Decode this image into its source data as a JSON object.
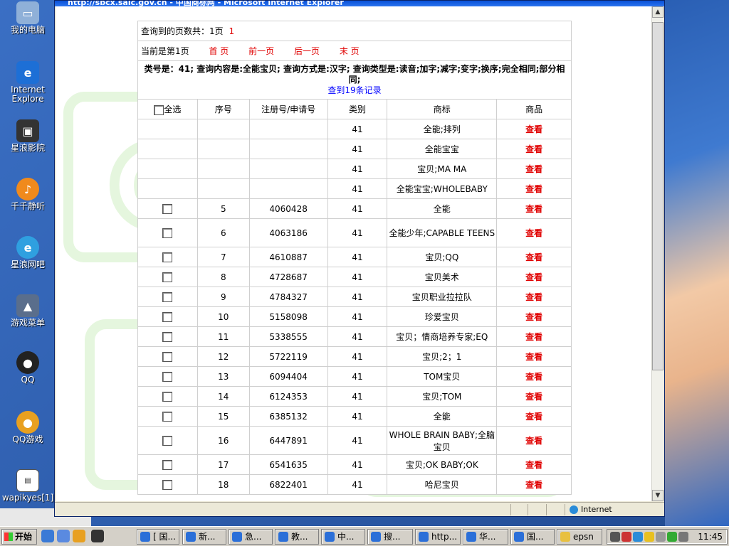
{
  "window": {
    "title": "http://sbcx.saic.gov.cn - 中国商标网 - Microsoft Internet Explorer",
    "status_zone": "Internet"
  },
  "desktop": {
    "icons": [
      "我的电脑",
      "Internet Explore",
      "星浪影院",
      "千千静听",
      "星浪网吧",
      "游戏菜单",
      "QQ",
      "QQ游戏",
      "wapikyes[1]"
    ]
  },
  "results": {
    "pages_label": "查询到的页数共：1页",
    "pages_link": "1",
    "current_label": "当前是第1页",
    "nav": [
      "首 页",
      "前一页",
      "后一页",
      "末 页"
    ],
    "info_line": "类号是：41; 查询内容是:全能宝贝; 查询方式是:汉字; 查询类型是:读音;加字;减字;变字;换序;完全相同;部分相同;",
    "found": "查到19条记录",
    "headers": {
      "select_all": "全选",
      "seq": "序号",
      "regno": "注册号/申请号",
      "class": "类别",
      "mark": "商标",
      "goods": "商品"
    },
    "view_label": "查看",
    "rows": [
      {
        "seq": "",
        "regno": "",
        "class": "41",
        "mark": "全能;排列",
        "hidden": true
      },
      {
        "seq": "",
        "regno": "",
        "class": "41",
        "mark": "全能宝宝",
        "hidden": true
      },
      {
        "seq": "",
        "regno": "",
        "class": "41",
        "mark": "宝贝;MA MA",
        "hidden": true
      },
      {
        "seq": "",
        "regno": "",
        "class": "41",
        "mark": "全能宝宝;WHOLEBABY",
        "hidden": true
      },
      {
        "seq": "5",
        "regno": "4060428",
        "class": "41",
        "mark": "全能"
      },
      {
        "seq": "6",
        "regno": "4063186",
        "class": "41",
        "mark": "全能少年;CAPABLE TEENS",
        "tall": true
      },
      {
        "seq": "7",
        "regno": "4610887",
        "class": "41",
        "mark": "宝贝;QQ"
      },
      {
        "seq": "8",
        "regno": "4728687",
        "class": "41",
        "mark": "宝贝美术"
      },
      {
        "seq": "9",
        "regno": "4784327",
        "class": "41",
        "mark": "宝贝职业拉拉队"
      },
      {
        "seq": "10",
        "regno": "5158098",
        "class": "41",
        "mark": "珍爱宝贝"
      },
      {
        "seq": "11",
        "regno": "5338555",
        "class": "41",
        "mark": "宝贝；情商培养专家;EQ"
      },
      {
        "seq": "12",
        "regno": "5722119",
        "class": "41",
        "mark": "宝贝;2；1"
      },
      {
        "seq": "13",
        "regno": "6094404",
        "class": "41",
        "mark": "TOM宝贝"
      },
      {
        "seq": "14",
        "regno": "6124353",
        "class": "41",
        "mark": "宝贝;TOM"
      },
      {
        "seq": "15",
        "regno": "6385132",
        "class": "41",
        "mark": "全能"
      },
      {
        "seq": "16",
        "regno": "6447891",
        "class": "41",
        "mark": "WHOLE BRAIN BABY;全脑宝贝",
        "tall": true
      },
      {
        "seq": "17",
        "regno": "6541635",
        "class": "41",
        "mark": "宝贝;OK BABY;OK"
      },
      {
        "seq": "18",
        "regno": "6822401",
        "class": "41",
        "mark": "哈尼宝贝"
      }
    ]
  },
  "taskbar": {
    "start": "开始",
    "tasks": [
      "[ 国...",
      "新...",
      "急...",
      "教...",
      "中...",
      "搜...",
      "http...",
      "华...",
      "国...",
      "epsn"
    ],
    "clock": "11:45"
  }
}
